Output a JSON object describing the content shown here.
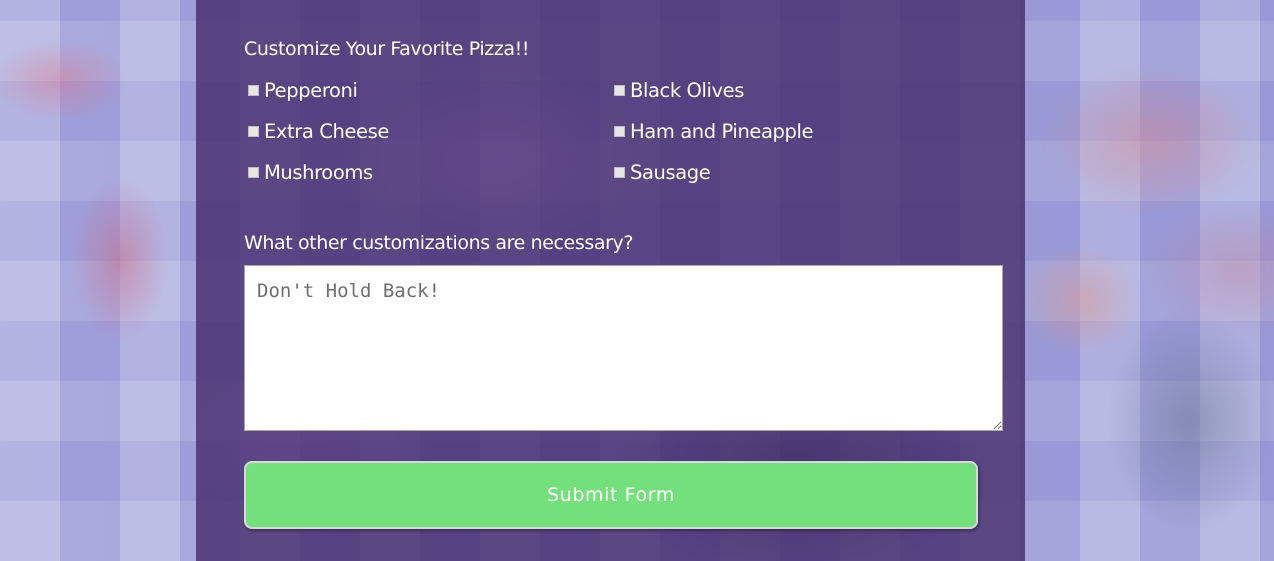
{
  "form": {
    "heading": "Customize Your Favorite Pizza!!",
    "toppings": [
      {
        "label": "Pepperoni",
        "checked": false
      },
      {
        "label": "Black Olives",
        "checked": false
      },
      {
        "label": "Extra Cheese",
        "checked": false
      },
      {
        "label": "Ham and Pineapple",
        "checked": false
      },
      {
        "label": "Mushrooms",
        "checked": false
      },
      {
        "label": "Sausage",
        "checked": false
      }
    ],
    "question": "What other customizations are necessary?",
    "notes": {
      "value": "",
      "placeholder": "Don't Hold Back!"
    },
    "submit_label": "Submit Form"
  },
  "colors": {
    "panel": "#462d6e",
    "submit_button": "#74e07c",
    "text": "#ffffff"
  }
}
